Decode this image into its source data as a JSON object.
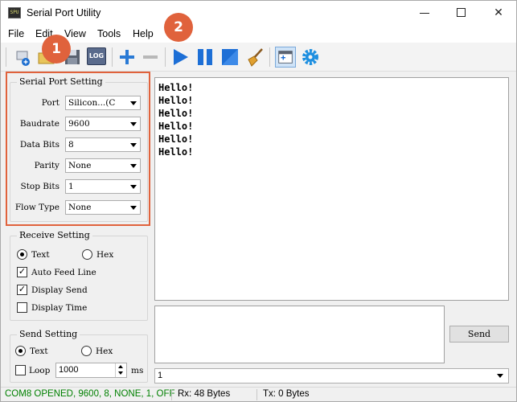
{
  "window": {
    "title": "Serial Port Utility",
    "minimize_glyph": "",
    "maximize_glyph": "",
    "close_glyph": "✕",
    "icon_text": "SPU"
  },
  "menu": {
    "items": [
      "File",
      "Edit",
      "View",
      "Tools",
      "Help"
    ]
  },
  "toolbar": {
    "icons": [
      "new-session-icon",
      "open-folder-icon",
      "save-icon",
      "log-icon",
      "add-icon",
      "remove-icon",
      "play-icon",
      "pause-icon",
      "stop-icon",
      "clear-broom-icon",
      "window-layout-icon",
      "settings-gear-icon"
    ],
    "log_label": "LOG"
  },
  "annotations": {
    "badge_1": "1",
    "badge_2": "2",
    "accent_color": "#e0623c"
  },
  "serial_port_setting": {
    "title": "Serial Port Setting",
    "port_label": "Port",
    "port_value": "Silicon...(C",
    "baudrate_label": "Baudrate",
    "baudrate_value": "9600",
    "data_bits_label": "Data Bits",
    "data_bits_value": "8",
    "parity_label": "Parity",
    "parity_value": "None",
    "stop_bits_label": "Stop Bits",
    "stop_bits_value": "1",
    "flow_type_label": "Flow Type",
    "flow_type_value": "None"
  },
  "receive_setting": {
    "title": "Receive Setting",
    "text_label": "Text",
    "hex_label": "Hex",
    "auto_feed_line_label": "Auto Feed Line",
    "display_send_label": "Display Send",
    "display_time_label": "Display Time"
  },
  "send_setting": {
    "title": "Send Setting",
    "text_label": "Text",
    "hex_label": "Hex",
    "loop_label": "Loop",
    "loop_value": "1000",
    "ms_label": "ms"
  },
  "receive_lines": [
    "Hello!",
    "Hello!",
    "Hello!",
    "Hello!",
    "Hello!",
    "Hello!"
  ],
  "send": {
    "button_label": "Send",
    "history_value": "1"
  },
  "status": {
    "connection": "COM8 OPENED, 9600, 8, NONE, 1, OFF",
    "rx": "Rx: 48 Bytes",
    "tx": "Tx: 0 Bytes",
    "connection_color": "#008000"
  }
}
